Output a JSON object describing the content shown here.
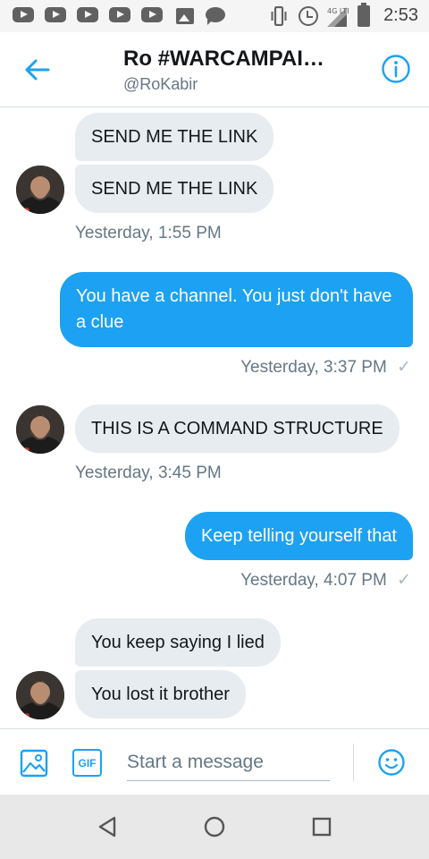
{
  "status_bar": {
    "time": "2:53",
    "network_label": "4G LTE",
    "notification_icons": [
      "youtube-icon",
      "youtube-icon",
      "youtube-icon",
      "youtube-icon",
      "youtube-icon",
      "gallery-icon",
      "chat-icon"
    ]
  },
  "header": {
    "title": "Ro #WARCAMPAI…",
    "handle": "@RoKabir",
    "back_icon": "back-arrow-icon",
    "info_icon": "info-icon"
  },
  "messages": [
    {
      "side": "in",
      "text": "SEND ME THE LINK"
    },
    {
      "side": "in",
      "text": "SEND ME THE LINK"
    },
    {
      "side": "in",
      "timestamp": "Yesterday, 1:55 PM"
    },
    {
      "side": "out",
      "text": "You have a channel. You just don't have a clue",
      "timestamp": "Yesterday, 3:37 PM",
      "status": "✓"
    },
    {
      "side": "in",
      "text": "THIS IS A COMMAND STRUCTURE",
      "timestamp": "Yesterday, 3:45 PM"
    },
    {
      "side": "out",
      "text": "Keep telling yourself that",
      "timestamp": "Yesterday, 4:07 PM",
      "status": "✓"
    },
    {
      "side": "in",
      "text": "You keep saying I lied"
    },
    {
      "side": "in",
      "text": "You lost it brother"
    }
  ],
  "composer": {
    "placeholder": "Start a message",
    "value": "",
    "gif_label": "GIF",
    "icons": [
      "image-icon",
      "gif-icon",
      "emoji-icon"
    ]
  },
  "nav": {
    "icons": [
      "back-triangle-icon",
      "home-circle-icon",
      "recents-square-icon"
    ]
  },
  "colors": {
    "accent": "#1da1f2",
    "incoming_bubble": "#e6ecf0",
    "secondary_text": "#657786"
  }
}
